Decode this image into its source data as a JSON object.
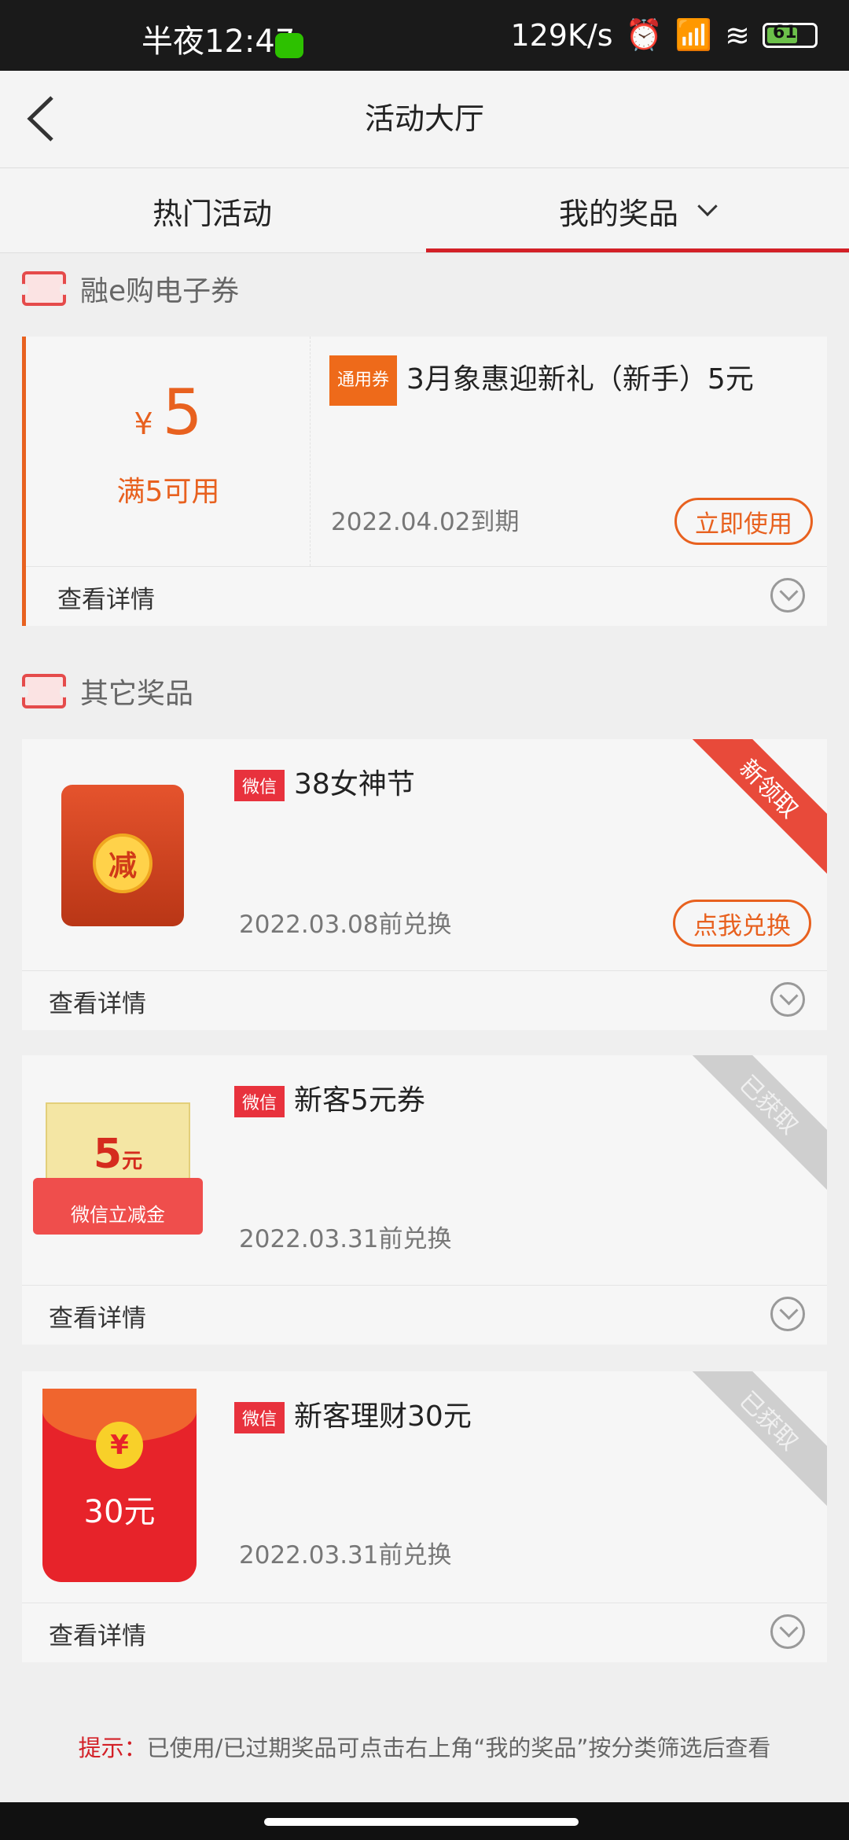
{
  "status_bar": {
    "time": "半夜12:47",
    "net_speed": "129K/s",
    "battery": "61"
  },
  "header": {
    "title": "活动大厅"
  },
  "tabs": {
    "hot": "热门活动",
    "mine": "我的奖品"
  },
  "section_coupons": {
    "title": "融e购电子券",
    "coupon": {
      "currency": "¥",
      "amount": "5",
      "condition": "满5可用",
      "tag": "通用券",
      "title": "3月象惠迎新礼（新手）5元",
      "expire": "2022.04.02到期",
      "action": "立即使用",
      "detail": "查看详情"
    }
  },
  "section_other": {
    "title": "其它奖品",
    "items": [
      {
        "tag": "微信",
        "title": "38女神节",
        "expire": "2022.03.08前兑换",
        "action": "点我兑换",
        "ribbon": "新领取",
        "detail": "查看详情",
        "image_text": "减"
      },
      {
        "tag": "微信",
        "title": "新客5元券",
        "expire": "2022.03.31前兑换",
        "ribbon": "已获取",
        "detail": "查看详情",
        "image_amount": "5",
        "image_unit": "元",
        "image_caption": "微信立减金"
      },
      {
        "tag": "微信",
        "title": "新客理财30元",
        "expire": "2022.03.31前兑换",
        "ribbon": "已获取",
        "detail": "查看详情",
        "image_symbol": "¥",
        "image_amount": "30元"
      }
    ]
  },
  "tip": {
    "label": "提示：",
    "text": "已使用/已过期奖品可点击右上角“我的奖品”按分类筛选后查看"
  },
  "colors": {
    "accent_red": "#d32027",
    "accent_orange": "#e8611f"
  },
  "icons": [
    "back-arrow-icon",
    "chevron-down-icon",
    "ticket-icon",
    "expand-circle-icon",
    "wechat-icon",
    "battery-icon"
  ]
}
